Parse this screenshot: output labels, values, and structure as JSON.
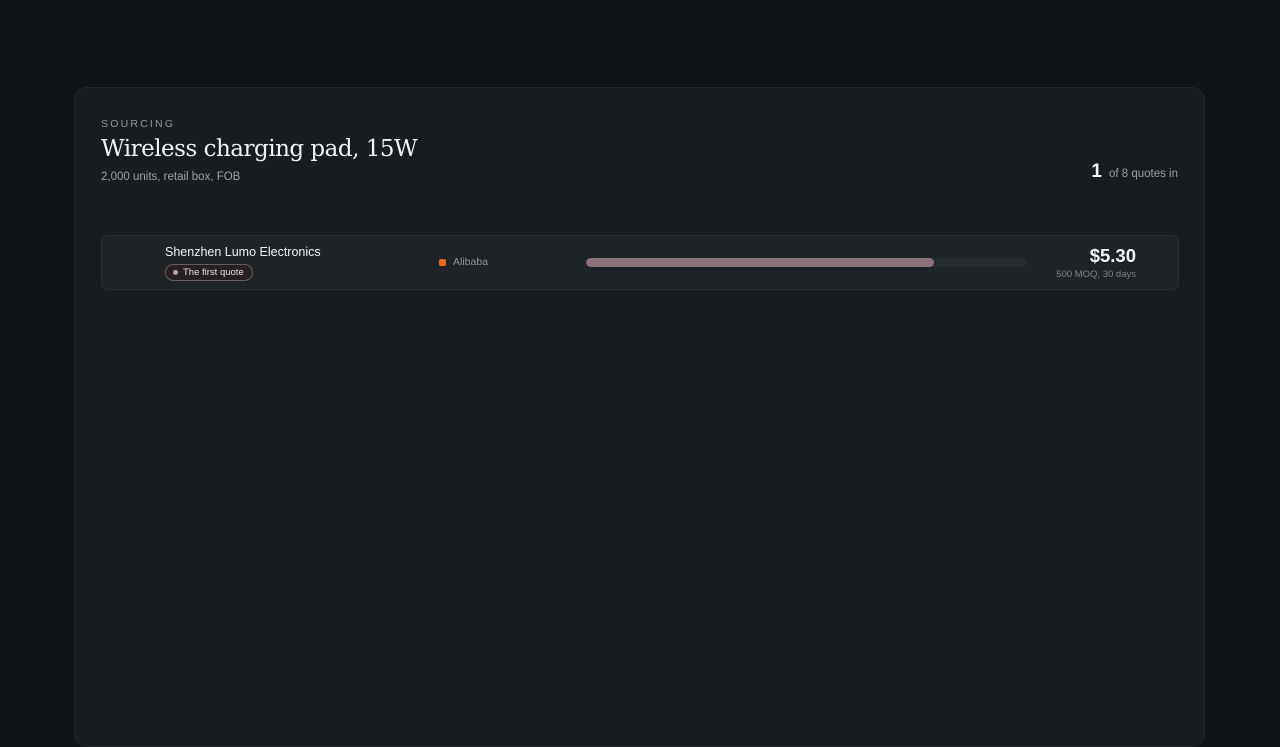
{
  "header": {
    "eyebrow": "SOURCING",
    "title": "Wireless charging pad, 15W",
    "subtitle": "2,000 units, retail box, FOB",
    "count_value": "1",
    "count_label": "of 8 quotes in"
  },
  "quotes": [
    {
      "supplier": "Shenzhen Lumo Electronics",
      "badge": "The first quote",
      "source": "Alibaba",
      "source_color": "#e8661e",
      "bar_fraction": 0.79,
      "bar_color": "#8a7278",
      "price": "$5.30",
      "terms": "500 MOQ, 30 days"
    }
  ]
}
